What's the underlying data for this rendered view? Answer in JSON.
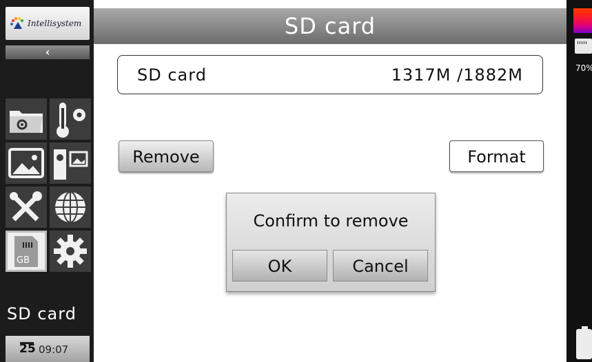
{
  "sidebar": {
    "logo_text": "Intellisystem",
    "back_label": "‹",
    "icons": [
      "folder-gear-icon",
      "thermometer-gear-icon",
      "image-icon",
      "camera-image-icon",
      "tools-icon",
      "globe-icon",
      "sd-card-icon",
      "settings-icon"
    ],
    "selected_icon": "sd-card-icon",
    "section_label": "SD card",
    "clock": {
      "day": "25",
      "time": "09:07"
    }
  },
  "header": {
    "title": "SD card"
  },
  "storage": {
    "label": "SD card",
    "value": "1317M /1882M"
  },
  "actions": {
    "remove_label": "Remove",
    "format_label": "Format"
  },
  "dialog": {
    "message": "Confirm to remove",
    "ok_label": "OK",
    "cancel_label": "Cancel"
  },
  "status": {
    "battery_percent": "70%"
  },
  "colors": {
    "title_bar": "#8a8a8a",
    "sidebar_bg": "#1c1c1c",
    "palette_top": "#ff3a00",
    "palette_bottom": "#7a00c8"
  }
}
